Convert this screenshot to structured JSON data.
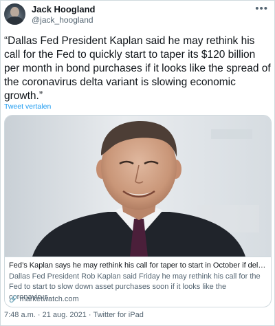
{
  "author": {
    "name": "Jack Hoogland",
    "handle": "@jack_hoogland"
  },
  "more_icon": "more-horizontal-icon",
  "tweet": {
    "text": "“Dallas Fed President Kaplan said he may rethink his call for the Fed to quickly start to taper its $120 billion per month in bond purchases if it looks like the spread of the coronavirus delta variant is slowing economic growth.”",
    "translate_label": "Tweet vertalen"
  },
  "card": {
    "title": "Fed’s Kaplan says he may rethink his call for taper to start in October if delta v...",
    "description": "Dallas Fed President Rob Kaplan said Friday he may rethink his call for the Fed to start to slow down asset purchases soon if it looks like the coronavirus...",
    "domain": "marketwatch.com",
    "domain_icon": "link-icon"
  },
  "meta": {
    "time": "7:48 a.m.",
    "separator1": " · ",
    "date": "21 aug. 2021",
    "separator2": " · ",
    "source": "Twitter for iPad"
  },
  "colors": {
    "link_blue": "#1d9bf0",
    "secondary_text": "#536471",
    "border": "#cfd9de"
  }
}
